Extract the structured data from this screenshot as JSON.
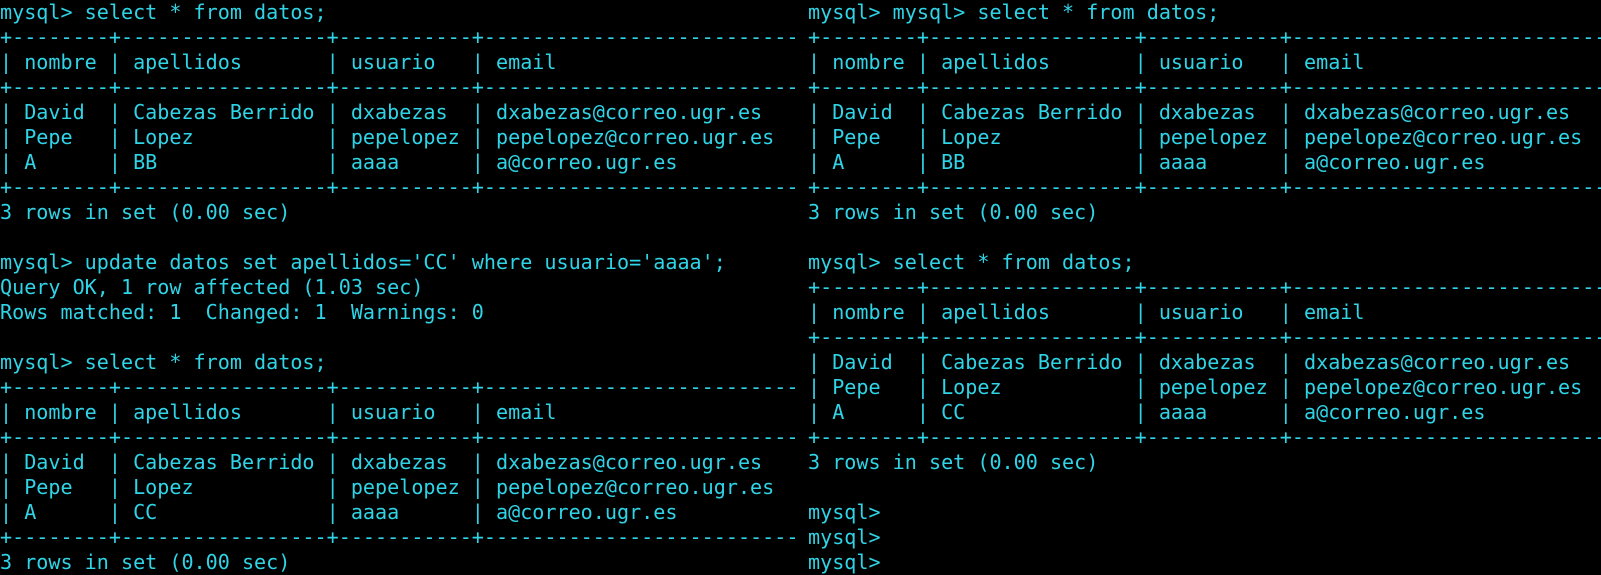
{
  "colors": {
    "background": "#000000",
    "foreground": "#2fd4e6"
  },
  "panes": {
    "left": {
      "lines": [
        "mysql> select * from datos;",
        "+--------+-----------------+-----------+---------------------------+",
        "| nombre | apellidos       | usuario   | email                     |",
        "+--------+-----------------+-----------+---------------------------+",
        "| David  | Cabezas Berrido | dxabezas  | dxabezas@correo.ugr.es    |",
        "| Pepe   | Lopez           | pepelopez | pepelopez@correo.ugr.es   |",
        "| A      | BB              | aaaa      | a@correo.ugr.es           |",
        "+--------+-----------------+-----------+---------------------------+",
        "3 rows in set (0.00 sec)",
        "",
        "mysql> update datos set apellidos='CC' where usuario='aaaa';",
        "Query OK, 1 row affected (1.03 sec)",
        "Rows matched: 1  Changed: 1  Warnings: 0",
        "",
        "mysql> select * from datos;",
        "+--------+-----------------+-----------+---------------------------+",
        "| nombre | apellidos       | usuario   | email                     |",
        "+--------+-----------------+-----------+---------------------------+",
        "| David  | Cabezas Berrido | dxabezas  | dxabezas@correo.ugr.es    |",
        "| Pepe   | Lopez           | pepelopez | pepelopez@correo.ugr.es   |",
        "| A      | CC              | aaaa      | a@correo.ugr.es           |",
        "+--------+-----------------+-----------+---------------------------+",
        "3 rows in set (0.00 sec)"
      ]
    },
    "right": {
      "lines": [
        "mysql> mysql> select * from datos;",
        "+--------+-----------------+-----------+---------------------------+",
        "| nombre | apellidos       | usuario   | email                     |",
        "+--------+-----------------+-----------+---------------------------+",
        "| David  | Cabezas Berrido | dxabezas  | dxabezas@correo.ugr.es    |",
        "| Pepe   | Lopez           | pepelopez | pepelopez@correo.ugr.es   |",
        "| A      | BB              | aaaa      | a@correo.ugr.es           |",
        "+--------+-----------------+-----------+---------------------------+",
        "3 rows in set (0.00 sec)",
        "",
        "mysql> select * from datos;",
        "+--------+-----------------+-----------+---------------------------+",
        "| nombre | apellidos       | usuario   | email                     |",
        "+--------+-----------------+-----------+---------------------------+",
        "| David  | Cabezas Berrido | dxabezas  | dxabezas@correo.ugr.es    |",
        "| Pepe   | Lopez           | pepelopez | pepelopez@correo.ugr.es   |",
        "| A      | CC              | aaaa      | a@correo.ugr.es           |",
        "+--------+-----------------+-----------+---------------------------+",
        "3 rows in set (0.00 sec)",
        "",
        "mysql> ",
        "mysql> ",
        "mysql> "
      ]
    }
  }
}
